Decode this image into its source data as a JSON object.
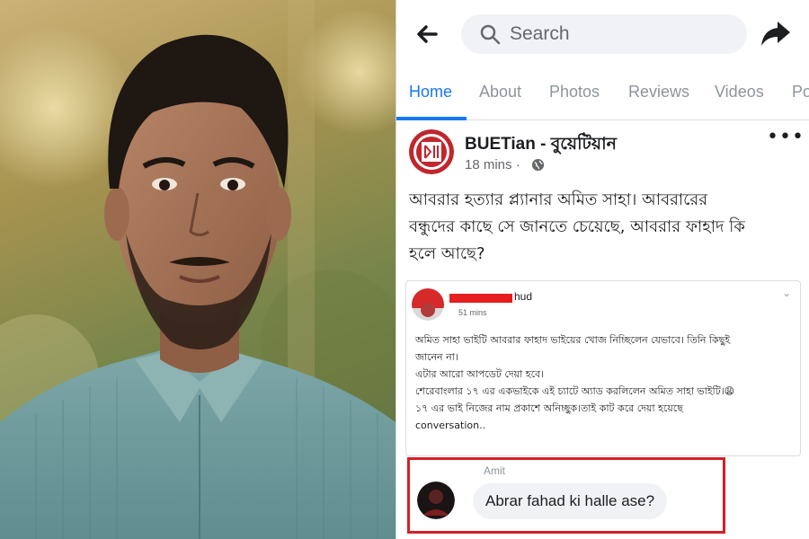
{
  "photo": {
    "description_icon": "person-portrait"
  },
  "header": {
    "back_icon": "arrow-left-icon",
    "search_icon": "search-icon",
    "search_placeholder": "Search",
    "share_icon": "share-arrow-icon"
  },
  "tabs": [
    {
      "label": "Home",
      "active": true
    },
    {
      "label": "About",
      "active": false
    },
    {
      "label": "Photos",
      "active": false
    },
    {
      "label": "Reviews",
      "active": false
    },
    {
      "label": "Videos",
      "active": false
    },
    {
      "label": "Po",
      "active": false
    }
  ],
  "post": {
    "page_name": "BUETian - বুয়েটিয়ান",
    "time": "18 mins ·",
    "more": "•••",
    "text_lines": [
      "আবরার হত্যার প্ল্যানার অমিত সাহা। আবরারের",
      "বন্ধুদের কাছে সে জানতে চেয়েছে, আবরার ফাহাদ কি",
      "হলে আছে?"
    ]
  },
  "shared_post": {
    "name_suffix": "hud",
    "time": "51 mins",
    "lines": [
      "অমিত সাহা ভাইটি আবরার ফাহাদ ভাইয়ের খোজ নিচ্ছিলেন যেভাবে। তিনি কিছুই",
      "জানেন না।",
      "এটার আরো আপডেট দেয়া হবে।",
      "শেরেবাংলার ১৭ এর একভাইকে এই চ্যাটে অ্যাড করলিলেন অমিত সাহা ভাইটি।😩",
      "১৭ এর ভাই নিজের নাম প্রকাশে অনিচ্ছুক।তাই কাট করে দেয়া হয়েছে",
      "conversation.."
    ]
  },
  "comment": {
    "author": "Amit",
    "text": "Abrar fahad ki halle ase?",
    "highlight_color": "#d42027"
  },
  "colors": {
    "accent": "#1877f2",
    "redaction": "#e51e1e"
  }
}
